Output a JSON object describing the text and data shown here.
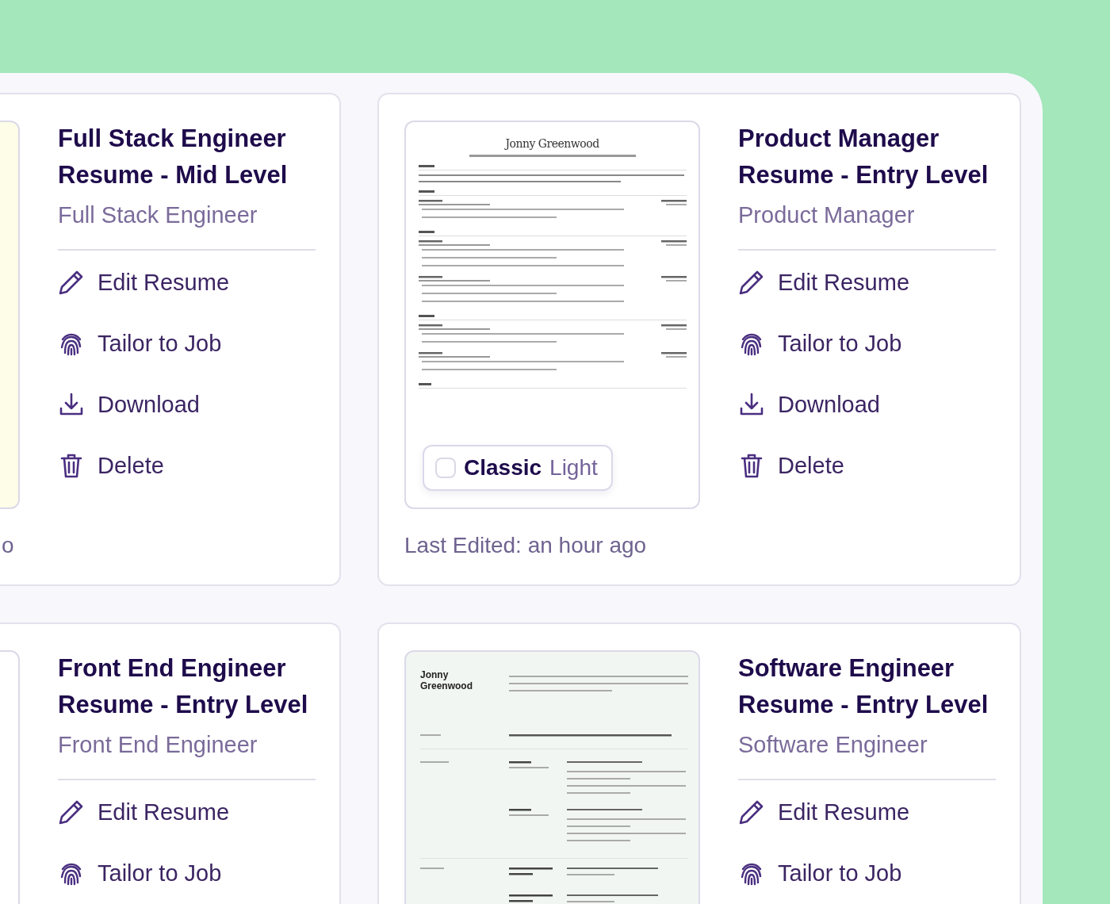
{
  "cards": [
    {
      "title": "Full Stack Engineer Resume - Mid Level",
      "subtitle": "Full Stack Engineer",
      "cut_off": true,
      "preview": {
        "kind": "blank",
        "color": "#fdfde8"
      },
      "actions": [
        {
          "kind": "edit",
          "label": "Edit Resume"
        },
        {
          "kind": "tailor",
          "label": "Tailor to Job"
        },
        {
          "kind": "download",
          "label": "Download"
        },
        {
          "kind": "delete",
          "label": "Delete"
        }
      ],
      "last_edited": "o"
    },
    {
      "title": "Product Manager Resume - Entry Level",
      "subtitle": "Product Manager",
      "cut_off": false,
      "preview": {
        "kind": "classic",
        "color": "#ffffff",
        "name": "Jonny Greenwood",
        "badge": {
          "checked": false,
          "name": "Classic",
          "variant": "Light"
        }
      },
      "actions": [
        {
          "kind": "edit",
          "label": "Edit Resume"
        },
        {
          "kind": "tailor",
          "label": "Tailor to Job"
        },
        {
          "kind": "download",
          "label": "Download"
        },
        {
          "kind": "delete",
          "label": "Delete"
        }
      ],
      "last_edited": "Last Edited: an hour ago"
    },
    {
      "title": "Front End Engineer Resume - Entry Level",
      "subtitle": "Front End Engineer",
      "preview": {
        "kind": "blank",
        "color": "#ffffff"
      },
      "actions": [
        {
          "kind": "edit",
          "label": "Edit Resume"
        },
        {
          "kind": "tailor",
          "label": "Tailor to Job"
        }
      ]
    },
    {
      "title": "Software Engineer Resume - Entry Level",
      "subtitle": "Software Engineer",
      "preview": {
        "kind": "modern",
        "color": "#f2f6f3",
        "name": "Jonny Greenwood"
      },
      "actions": [
        {
          "kind": "edit",
          "label": "Edit Resume"
        },
        {
          "kind": "tailor",
          "label": "Tailor to Job"
        }
      ]
    }
  ]
}
